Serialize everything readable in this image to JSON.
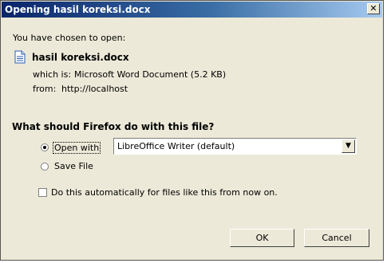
{
  "dialog": {
    "title": "Opening hasil koreksi.docx",
    "close_glyph": "✕",
    "intro": "You have chosen to open:",
    "file_name": "hasil koreksi.docx",
    "which_is_label": "which is:",
    "which_is_value": "Microsoft Word Document (5.2 KB)",
    "from_label": "from:",
    "from_value": "http://localhost",
    "question": "What should Firefox do with this file?",
    "open_with_label": "Open with",
    "open_with_app": "LibreOffice Writer (default)",
    "save_file_label": "Save File",
    "auto_label": "Do this automatically for files like this from now on.",
    "ok_label": "OK",
    "cancel_label": "Cancel"
  },
  "icons": {
    "file": "document-icon",
    "close": "close-icon",
    "dropdown": "chevron-down-icon"
  },
  "colors": {
    "titlebar_start": "#0a246a",
    "titlebar_end": "#a6caf0",
    "face": "#ece9d8"
  },
  "state": {
    "open_with_selected": true,
    "save_file_selected": false,
    "auto_checked": false
  }
}
